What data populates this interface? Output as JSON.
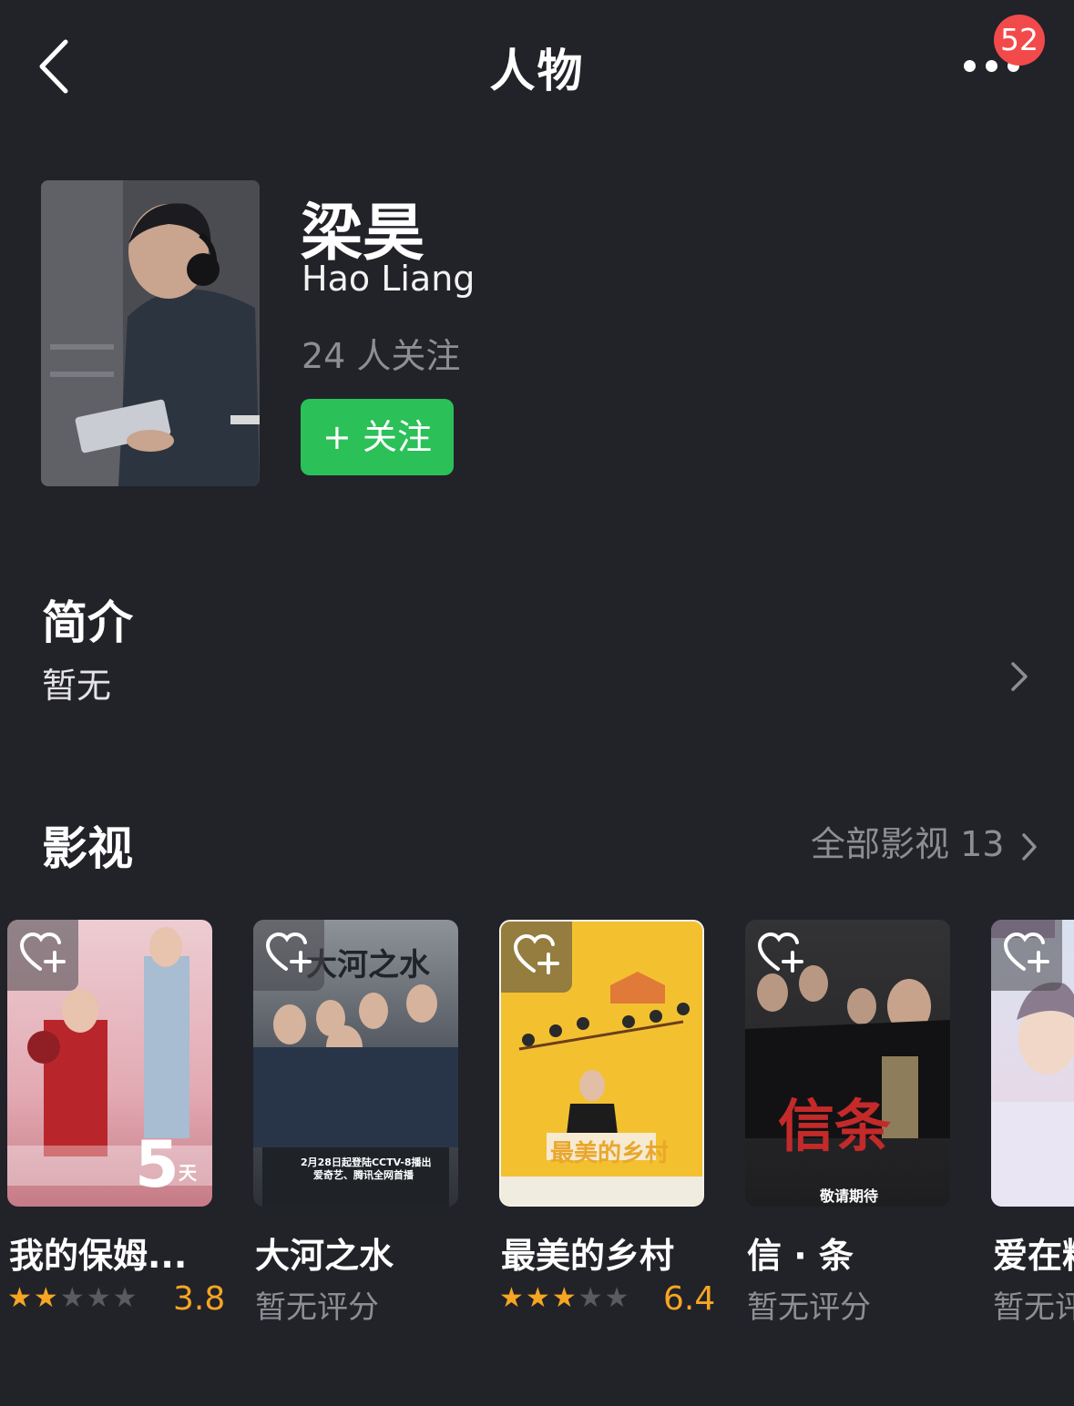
{
  "header": {
    "title": "人物",
    "badge_count": "52"
  },
  "profile": {
    "name": "梁昊",
    "english_name": "Hao Liang",
    "follow_count": "24 人关注",
    "follow_button": "+ 关注"
  },
  "intro": {
    "title": "简介",
    "text": "暂无"
  },
  "works": {
    "title": "影视",
    "all_label": "全部影视 13",
    "items": [
      {
        "title": "我的保姆...",
        "rating": "3.8",
        "stars": 2,
        "poster_overlay": "5",
        "poster_unit": "天",
        "colors": [
          "#e9bcc3",
          "#c4848f"
        ]
      },
      {
        "title": "大河之水",
        "rating": "暂无评分",
        "poster_overlay": "大河之水",
        "poster_sub": "2月28日起登陆CCTV-8播出",
        "poster_sub2": "爱奇艺、腾讯全网首播",
        "colors": [
          "#7a7f86",
          "#3d4148"
        ]
      },
      {
        "title": "最美的乡村",
        "rating": "6.4",
        "stars": 3,
        "poster_overlay": "最美的乡村",
        "colors": [
          "#f6c430",
          "#e5a91c"
        ]
      },
      {
        "title": "信 · 条",
        "rating": "暂无评分",
        "poster_overlay": "信条",
        "poster_sub": "敬请期待",
        "colors": [
          "#2c2c2e",
          "#141415"
        ]
      },
      {
        "title": "爱在粉",
        "rating": "暂无评",
        "colors": [
          "#dfe4f2",
          "#f1d8e4"
        ]
      }
    ]
  }
}
